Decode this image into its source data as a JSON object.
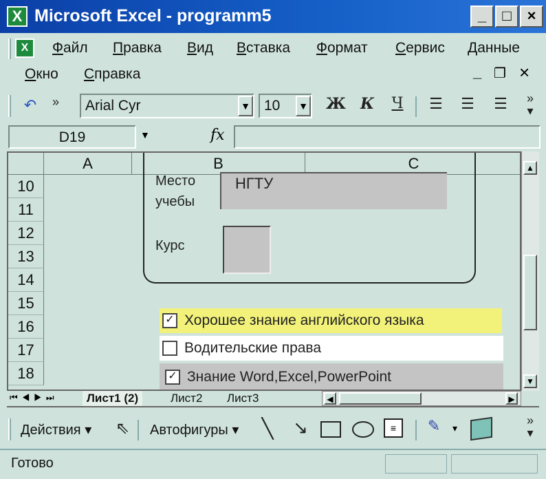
{
  "window": {
    "title": "Microsoft Excel - programm5",
    "app_icon": "X",
    "minimize": "_",
    "maximize": "□",
    "close": "×"
  },
  "menu": {
    "row1": [
      "Файл",
      "Правка",
      "Вид",
      "Вставка",
      "Формат",
      "Сервис",
      "Данные"
    ],
    "row2": [
      "Окно",
      "Справка"
    ]
  },
  "toolbar": {
    "font_name": "Arial Cyr",
    "font_size": "10",
    "bold": "Ж",
    "italic": "К",
    "underline": "Ч"
  },
  "formula": {
    "name_box": "D19",
    "fx": "fx",
    "value": ""
  },
  "sheet": {
    "columns": [
      "A",
      "B",
      "C"
    ],
    "rows": [
      "10",
      "11",
      "12",
      "13",
      "14",
      "15",
      "16",
      "17",
      "18"
    ],
    "form": {
      "study_label_1": "Место",
      "study_label_2": "учебы",
      "study_value": "НГТУ",
      "course_label": "Курс"
    },
    "checkboxes": [
      {
        "label": "Хорошее знание английского языка",
        "checked": true
      },
      {
        "label": "Водительские права",
        "checked": false
      },
      {
        "label": "Знание Word,Excel,PowerPoint",
        "checked": true
      }
    ]
  },
  "tabs": [
    "Лист1 (2)",
    "Лист2",
    "Лист3"
  ],
  "drawing": {
    "actions": "Действия",
    "autoshapes": "Автофигуры"
  },
  "status": {
    "text": "Готово"
  }
}
